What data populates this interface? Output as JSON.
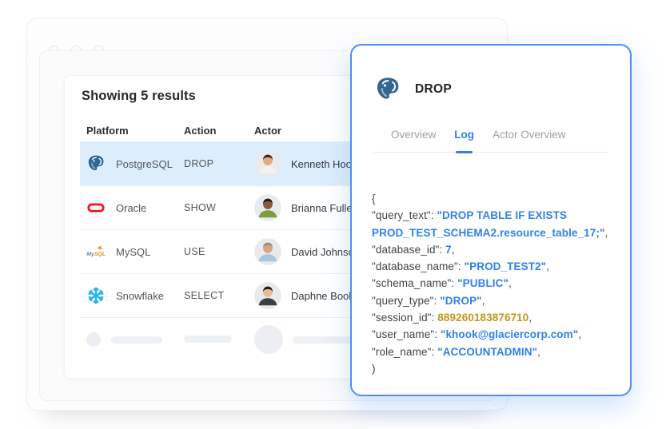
{
  "results_header": "Showing 5 results",
  "table": {
    "columns": [
      "Platform",
      "Action",
      "Actor"
    ],
    "rows": [
      {
        "platform": "PostgreSQL",
        "icon": "postgresql-icon",
        "action": "DROP",
        "actor": "Kenneth Hook",
        "avatar": "avatar-kenneth",
        "highlighted": true
      },
      {
        "platform": "Oracle",
        "icon": "oracle-icon",
        "action": "SHOW",
        "actor": "Brianna Fuller",
        "avatar": "avatar-brianna",
        "highlighted": false
      },
      {
        "platform": "MySQL",
        "icon": "mysql-icon",
        "action": "USE",
        "actor": "David Johnson",
        "avatar": "avatar-david",
        "highlighted": false
      },
      {
        "platform": "Snowflake",
        "icon": "snowflake-icon",
        "action": "SELECT",
        "actor": "Daphne Booker",
        "avatar": "avatar-daphne",
        "highlighted": false
      }
    ],
    "has_skeleton_row": true
  },
  "panel": {
    "title": "DROP",
    "title_icon": "postgresql-icon",
    "tabs": [
      {
        "label": "Overview",
        "active": false
      },
      {
        "label": "Log",
        "active": true
      },
      {
        "label": "Actor Overview",
        "active": false
      }
    ],
    "log_lines": [
      [
        {
          "text": "{",
          "type": "plain"
        }
      ],
      [
        {
          "text": "\"query_text\": ",
          "type": "key"
        },
        {
          "text": "\"DROP TABLE IF EXISTS",
          "type": "string"
        }
      ],
      [
        {
          "text": "PROD_TEST_SCHEMA2.resource_table_17;\"",
          "type": "string"
        },
        {
          "text": ",",
          "type": "plain"
        }
      ],
      [
        {
          "text": "\"database_id\": ",
          "type": "key"
        },
        {
          "text": "7",
          "type": "number"
        },
        {
          "text": ",",
          "type": "plain"
        }
      ],
      [
        {
          "text": "\"database_name\": ",
          "type": "key"
        },
        {
          "text": "\"PROD_TEST2\"",
          "type": "string"
        },
        {
          "text": ",",
          "type": "plain"
        }
      ],
      [
        {
          "text": "\"schema_name\": ",
          "type": "key"
        },
        {
          "text": "\"PUBLIC\"",
          "type": "string"
        },
        {
          "text": ",",
          "type": "plain"
        }
      ],
      [
        {
          "text": "\"query_type\": ",
          "type": "key"
        },
        {
          "text": "\"DROP\"",
          "type": "string"
        },
        {
          "text": ",",
          "type": "plain"
        }
      ],
      [
        {
          "text": "\"session_id\": ",
          "type": "key"
        },
        {
          "text": "889260183876710",
          "type": "session"
        },
        {
          "text": ",",
          "type": "plain"
        }
      ],
      [
        {
          "text": "\"user_name\": ",
          "type": "key"
        },
        {
          "text": "\"khook@glaciercorp.com\"",
          "type": "string"
        },
        {
          "text": ",",
          "type": "plain"
        }
      ],
      [
        {
          "text": "\"role_name\": ",
          "type": "key"
        },
        {
          "text": "\"ACCOUNTADMIN\"",
          "type": "string"
        },
        {
          "text": ",",
          "type": "plain"
        }
      ],
      [
        {
          "text": ")",
          "type": "plain"
        }
      ]
    ]
  },
  "colors": {
    "accent_blue": "#2f80ed",
    "panel_border": "#4a90f8",
    "row_highlight": "#dceefc",
    "session_gold": "#c5951f",
    "snowflake_blue": "#29b5e8",
    "oracle_red": "#ea1b22",
    "postgres_blue": "#336791"
  }
}
